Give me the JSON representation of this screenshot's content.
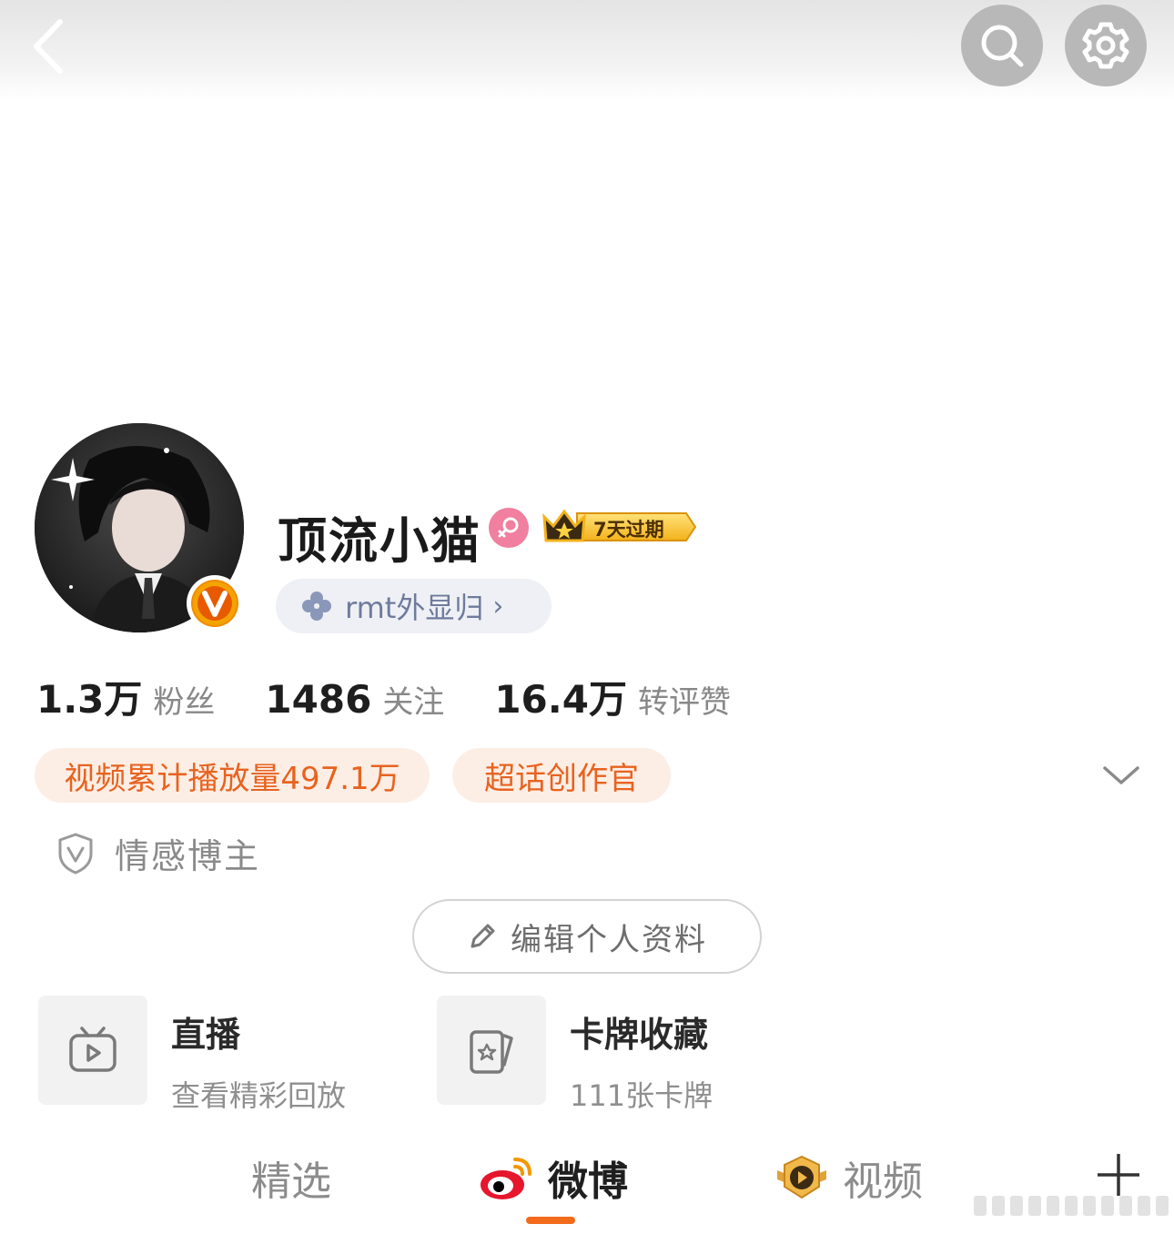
{
  "nav": {
    "back_icon": "chevron-left-icon",
    "search_icon": "search-icon",
    "settings_icon": "gear-icon"
  },
  "profile": {
    "username": "顶流小猫",
    "gender_icon": "female-icon",
    "vip_badge_text": "7天过期",
    "tag_pill": "rmt外显归",
    "tag_icon": "clover-icon",
    "verified_icon": "v-verified-icon"
  },
  "stats": [
    {
      "value": "1.3万",
      "label": "粉丝"
    },
    {
      "value": "1486",
      "label": "关注"
    },
    {
      "value": "16.4万",
      "label": "转评赞"
    }
  ],
  "chips": [
    "视频累计播放量497.1万",
    "超话创作官"
  ],
  "category": "情感博主",
  "edit_button": "编辑个人资料",
  "cards": [
    {
      "title": "直播",
      "subtitle": "查看精彩回放",
      "icon": "tv-play-icon"
    },
    {
      "title": "卡牌收藏",
      "subtitle": "111张卡牌",
      "icon": "card-star-icon"
    }
  ],
  "tabs": [
    {
      "label": "精选",
      "active": false
    },
    {
      "label": "微博",
      "active": true,
      "icon": "weibo-logo-icon"
    },
    {
      "label": "视频",
      "active": false,
      "icon": "video-badge-icon"
    }
  ],
  "colors": {
    "accent": "#f26a1b",
    "chip_bg": "#fdeee5",
    "chip_text": "#e8631f",
    "pill_bg": "#eef0f5",
    "pill_text": "#6f7b9c"
  }
}
